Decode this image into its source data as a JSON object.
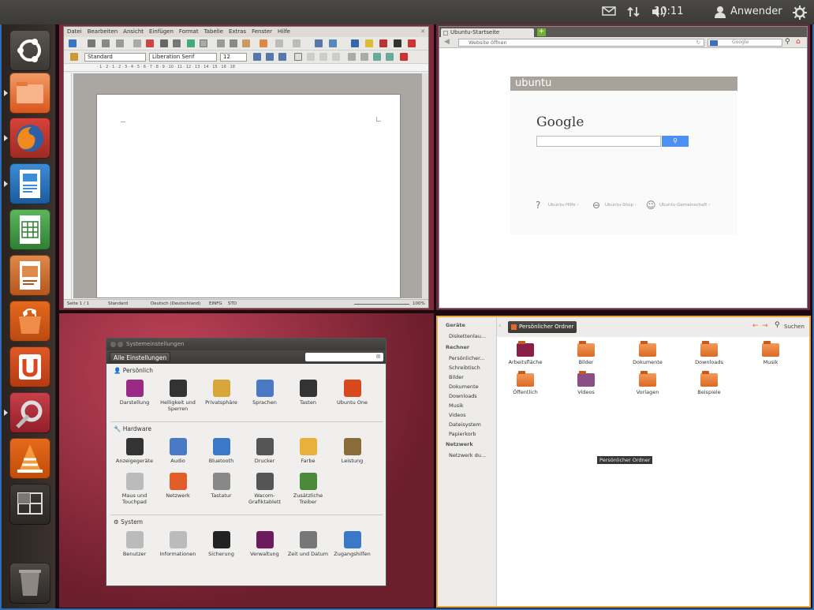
{
  "panel": {
    "clock": "10:11",
    "user": "Anwender",
    "icons": [
      "mail-icon",
      "network-icon",
      "volume-icon",
      "user-icon",
      "gear-icon"
    ]
  },
  "launcher": {
    "items": [
      "dash-home-icon",
      "files-icon",
      "firefox-icon",
      "writer-icon",
      "calc-icon",
      "impress-icon",
      "software-center-icon",
      "ubuntu-one-icon",
      "system-settings-icon",
      "vlc-icon",
      "workspace-switcher-icon",
      "trash-icon"
    ]
  },
  "writer": {
    "menu": [
      "Datei",
      "Bearbeiten",
      "Ansicht",
      "Einfügen",
      "Format",
      "Tabelle",
      "Extras",
      "Fenster",
      "Hilfe"
    ],
    "style": "Standard",
    "font": "Liberation Serif",
    "size": "12",
    "ruler": "· 1 · 2 · 1 · 2 · 3 · 4 · 5 · 6 · 7 · 8 · 9 · 10 · 11 · 12 · 13 · 14 · 15 · 16 · 18",
    "status": {
      "page": "Seite 1 / 1",
      "style": "Standard",
      "lang": "Deutsch (Deutschland)",
      "mode": "EINFG",
      "std": "STD",
      "zoom": "100%"
    }
  },
  "browser": {
    "tab": "Ubuntu-Startseite",
    "url_placeholder": "Website öffnen",
    "search_placeholder": "Google",
    "brand": "ubuntu",
    "google": "Google",
    "links": [
      "Ubuntu-Hilfe ›",
      "Ubuntu-Shop ›",
      "Ubuntu-Gemeinschaft ›"
    ]
  },
  "settings": {
    "title": "Systemeinstellungen",
    "all_button": "Alle Einstellungen",
    "sections": [
      {
        "name": "Persönlich",
        "items": [
          "Darstellung",
          "Helligkeit und Sperren",
          "Privatsphäre",
          "Sprachen",
          "Tasten",
          "Ubuntu One"
        ]
      },
      {
        "name": "Hardware",
        "items": [
          "Anzeigegeräte",
          "Audio",
          "Bluetooth",
          "Drucker",
          "Farbe",
          "Leistung",
          "Maus und Touchpad",
          "Netzwerk",
          "Tastatur",
          "Wacom-Grafiktablett",
          "Zusätzliche Treiber"
        ]
      },
      {
        "name": "System",
        "items": [
          "Benutzer",
          "Informationen",
          "Sicherung",
          "Verwaltung",
          "Zeit und Datum",
          "Zugangshilfen"
        ]
      }
    ]
  },
  "files": {
    "sidebar": {
      "geraete": "Geräte",
      "disk": "Diskettenlau...",
      "rechner": "Rechner",
      "rechner_items": [
        "Persönlicher...",
        "Schreibtisch",
        "Bilder",
        "Dokumente",
        "Downloads",
        "Musik",
        "Videos",
        "Dateisystem",
        "Papierkorb"
      ],
      "netzwerk": "Netzwerk",
      "netz_items": [
        "Netzwerk du..."
      ]
    },
    "crumb": "Persönlicher Ordner",
    "search": "Suchen",
    "folders": [
      "Arbeitsfläche",
      "Bilder",
      "Dokumente",
      "Downloads",
      "Musik",
      "Öffentlich",
      "Videos",
      "Vorlagen",
      "Beispiele"
    ],
    "tooltip": "Persönlicher Ordner"
  }
}
